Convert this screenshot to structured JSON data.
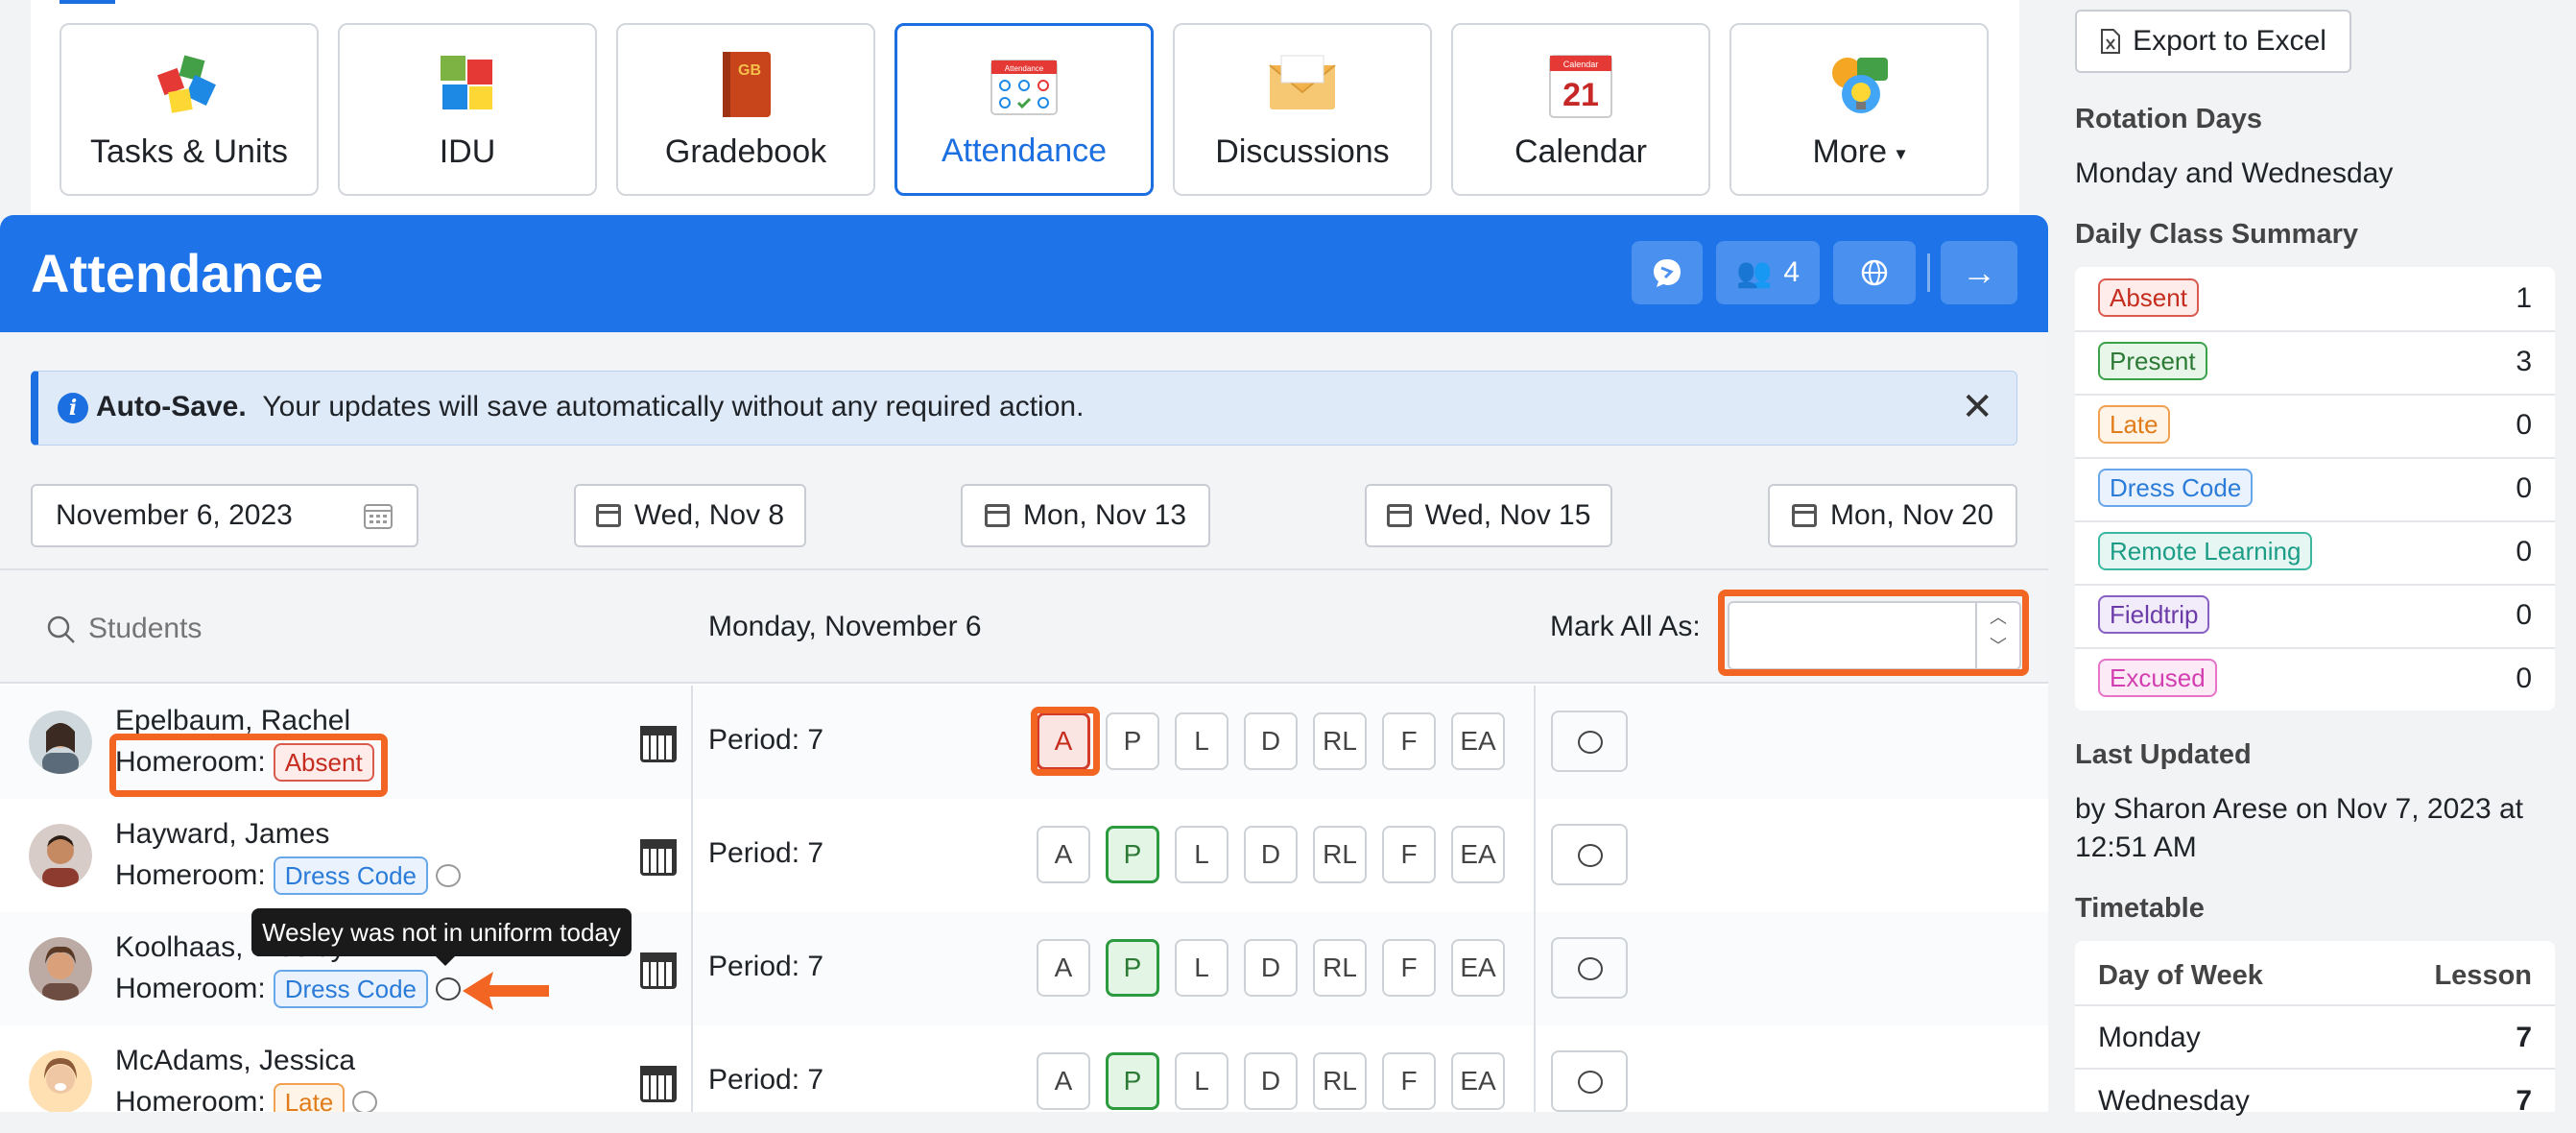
{
  "tools": [
    {
      "label": "Tasks & Units",
      "icon": "puzzle-icon"
    },
    {
      "label": "IDU",
      "icon": "puzzle-pieces-icon"
    },
    {
      "label": "Gradebook",
      "icon": "gradebook-icon"
    },
    {
      "label": "Attendance",
      "icon": "attendance-icon",
      "active": true
    },
    {
      "label": "Discussions",
      "icon": "envelope-icon"
    },
    {
      "label": "Calendar",
      "icon": "calendar-icon"
    },
    {
      "label": "More",
      "icon": "lightbulb-icon"
    }
  ],
  "icon_text": {
    "gradebook": "GB",
    "attendance": "Attendance",
    "calendar_head": "Calendar",
    "calendar_day": "21"
  },
  "panel": {
    "title": "Attendance",
    "students_count": "4",
    "alert_bold": "Auto-Save.",
    "alert_text": "Your updates will save automatically without any required action.",
    "date_field": "November 6, 2023",
    "dates": [
      "Wed, Nov 8",
      "Mon, Nov 13",
      "Wed, Nov 15",
      "Mon, Nov 20"
    ],
    "search_placeholder": "Students",
    "day_heading": "Monday, November 6",
    "mark_all_label": "Mark All As:",
    "mark_all_value": ""
  },
  "codes": [
    "A",
    "P",
    "L",
    "D",
    "RL",
    "F",
    "EA"
  ],
  "students": [
    {
      "name": "Epelbaum, Rachel",
      "homeroom_label": "Homeroom:",
      "status": "Absent",
      "status_class": "b-absent",
      "period": "Period: 7",
      "selected": "A",
      "has_comment": false
    },
    {
      "name": "Hayward, James",
      "homeroom_label": "Homeroom:",
      "status": "Dress Code",
      "status_class": "b-dress",
      "period": "Period: 7",
      "selected": "P",
      "has_comment": true
    },
    {
      "name": "Koolhaas, Wesley",
      "homeroom_label": "Homeroom:",
      "status": "Dress Code",
      "status_class": "b-dress",
      "period": "Period: 7",
      "selected": "P",
      "has_comment": true
    },
    {
      "name": "McAdams, Jessica",
      "homeroom_label": "Homeroom:",
      "status": "Late",
      "status_class": "b-late",
      "period": "Period: 7",
      "selected": "P",
      "has_comment": true
    }
  ],
  "tooltip": "Wesley was not in uniform today",
  "sidebar": {
    "export_label": "Export to Excel",
    "rotation_title": "Rotation Days",
    "rotation_value": "Monday and Wednesday",
    "summary_title": "Daily Class Summary",
    "summary": [
      {
        "label": "Absent",
        "count": "1",
        "cls": "b-absent"
      },
      {
        "label": "Present",
        "count": "3",
        "cls": "b-present"
      },
      {
        "label": "Late",
        "count": "0",
        "cls": "b-late"
      },
      {
        "label": "Dress Code",
        "count": "0",
        "cls": "b-dress"
      },
      {
        "label": "Remote Learning",
        "count": "0",
        "cls": "b-remote"
      },
      {
        "label": "Fieldtrip",
        "count": "0",
        "cls": "b-field"
      },
      {
        "label": "Excused",
        "count": "0",
        "cls": "b-exc"
      }
    ],
    "updated_title": "Last Updated",
    "updated_text_1": "by Sharon Arese on Nov 7, 2023 at",
    "updated_text_2": "12:51 AM",
    "timetable_title": "Timetable",
    "tt_col1": "Day of Week",
    "tt_col2": "Lesson",
    "timetable": [
      {
        "day": "Monday",
        "lesson": "7"
      },
      {
        "day": "Wednesday",
        "lesson": "7"
      }
    ]
  },
  "colors": {
    "accent": "#1e73e8",
    "highlight": "#f26522"
  }
}
